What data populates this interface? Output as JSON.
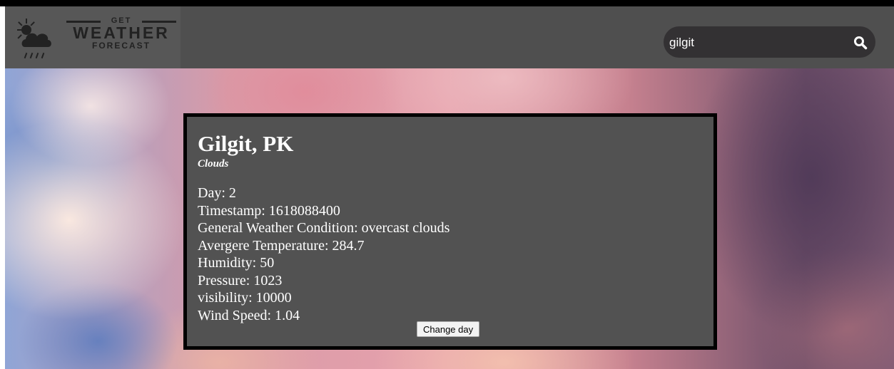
{
  "logo": {
    "line1": "GET",
    "line2": "WEATHER",
    "line3": "FORECAST"
  },
  "search": {
    "value": "gilgit",
    "icon": "search-icon"
  },
  "card": {
    "city": "Gilgit, PK",
    "condition": "Clouds",
    "details": [
      "Day: 2",
      "Timestamp: 1618088400",
      "General Weather Condition: overcast clouds",
      "Avergere Temperature: 284.7",
      "Humidity: 50",
      "Pressure: 1023",
      "visibility: 10000",
      "Wind Speed: 1.04"
    ],
    "button_label": "Change day"
  },
  "colors": {
    "header": "#4f4f4f",
    "card_bg": "#525252",
    "search_bg": "#333133"
  }
}
